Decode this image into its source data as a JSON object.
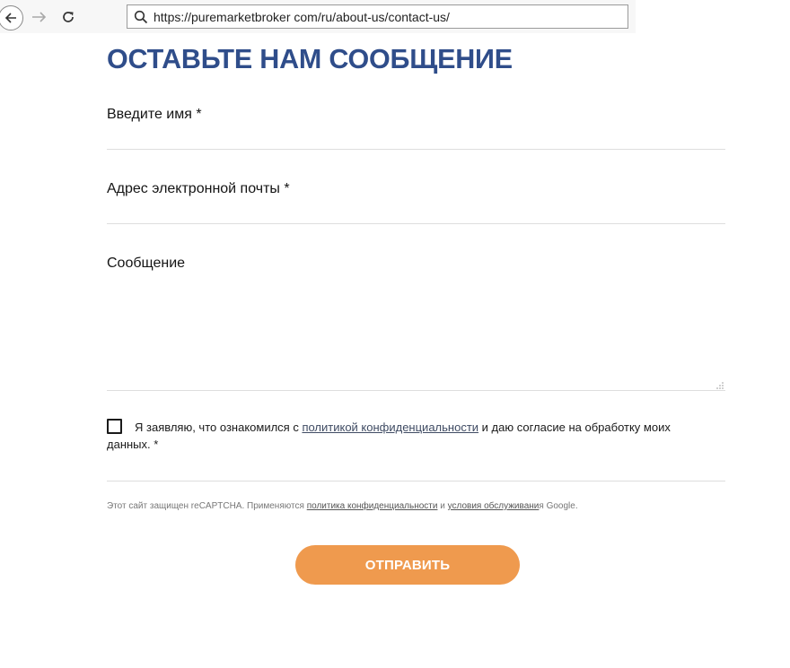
{
  "browser": {
    "url": "https://puremarketbroker com/ru/about-us/contact-us/",
    "icons": {
      "back": "arrow-left-icon",
      "forward": "arrow-right-icon",
      "reload": "reload-icon",
      "search": "search-icon"
    }
  },
  "form": {
    "title": "ОСТАВЬТЕ НАМ СООБЩЕНИЕ",
    "fields": {
      "name_label": "Введите имя *",
      "name_value": "",
      "email_label": "Адрес электронной почты *",
      "email_value": "",
      "message_label": "Сообщение",
      "message_value": ""
    },
    "consent": {
      "checked": false,
      "text_before": "Я заявляю, что ознакомился с ",
      "link": "политикой конфиденциальности",
      "text_after": " и даю согласие на обработку моих данных. *"
    },
    "captcha": {
      "text_before": "Этот сайт защищен reCAPTCHA. Применяются ",
      "privacy_link": "политика конфиденциальности",
      "and": " и ",
      "terms_link": "условия обслуживани",
      "text_after": "я Google."
    },
    "submit_label": "ОТПРАВИТЬ"
  },
  "colors": {
    "title": "#2f4d8a",
    "button": "#ef9a4e",
    "button_text": "#ffffff",
    "divider": "#dedede"
  }
}
